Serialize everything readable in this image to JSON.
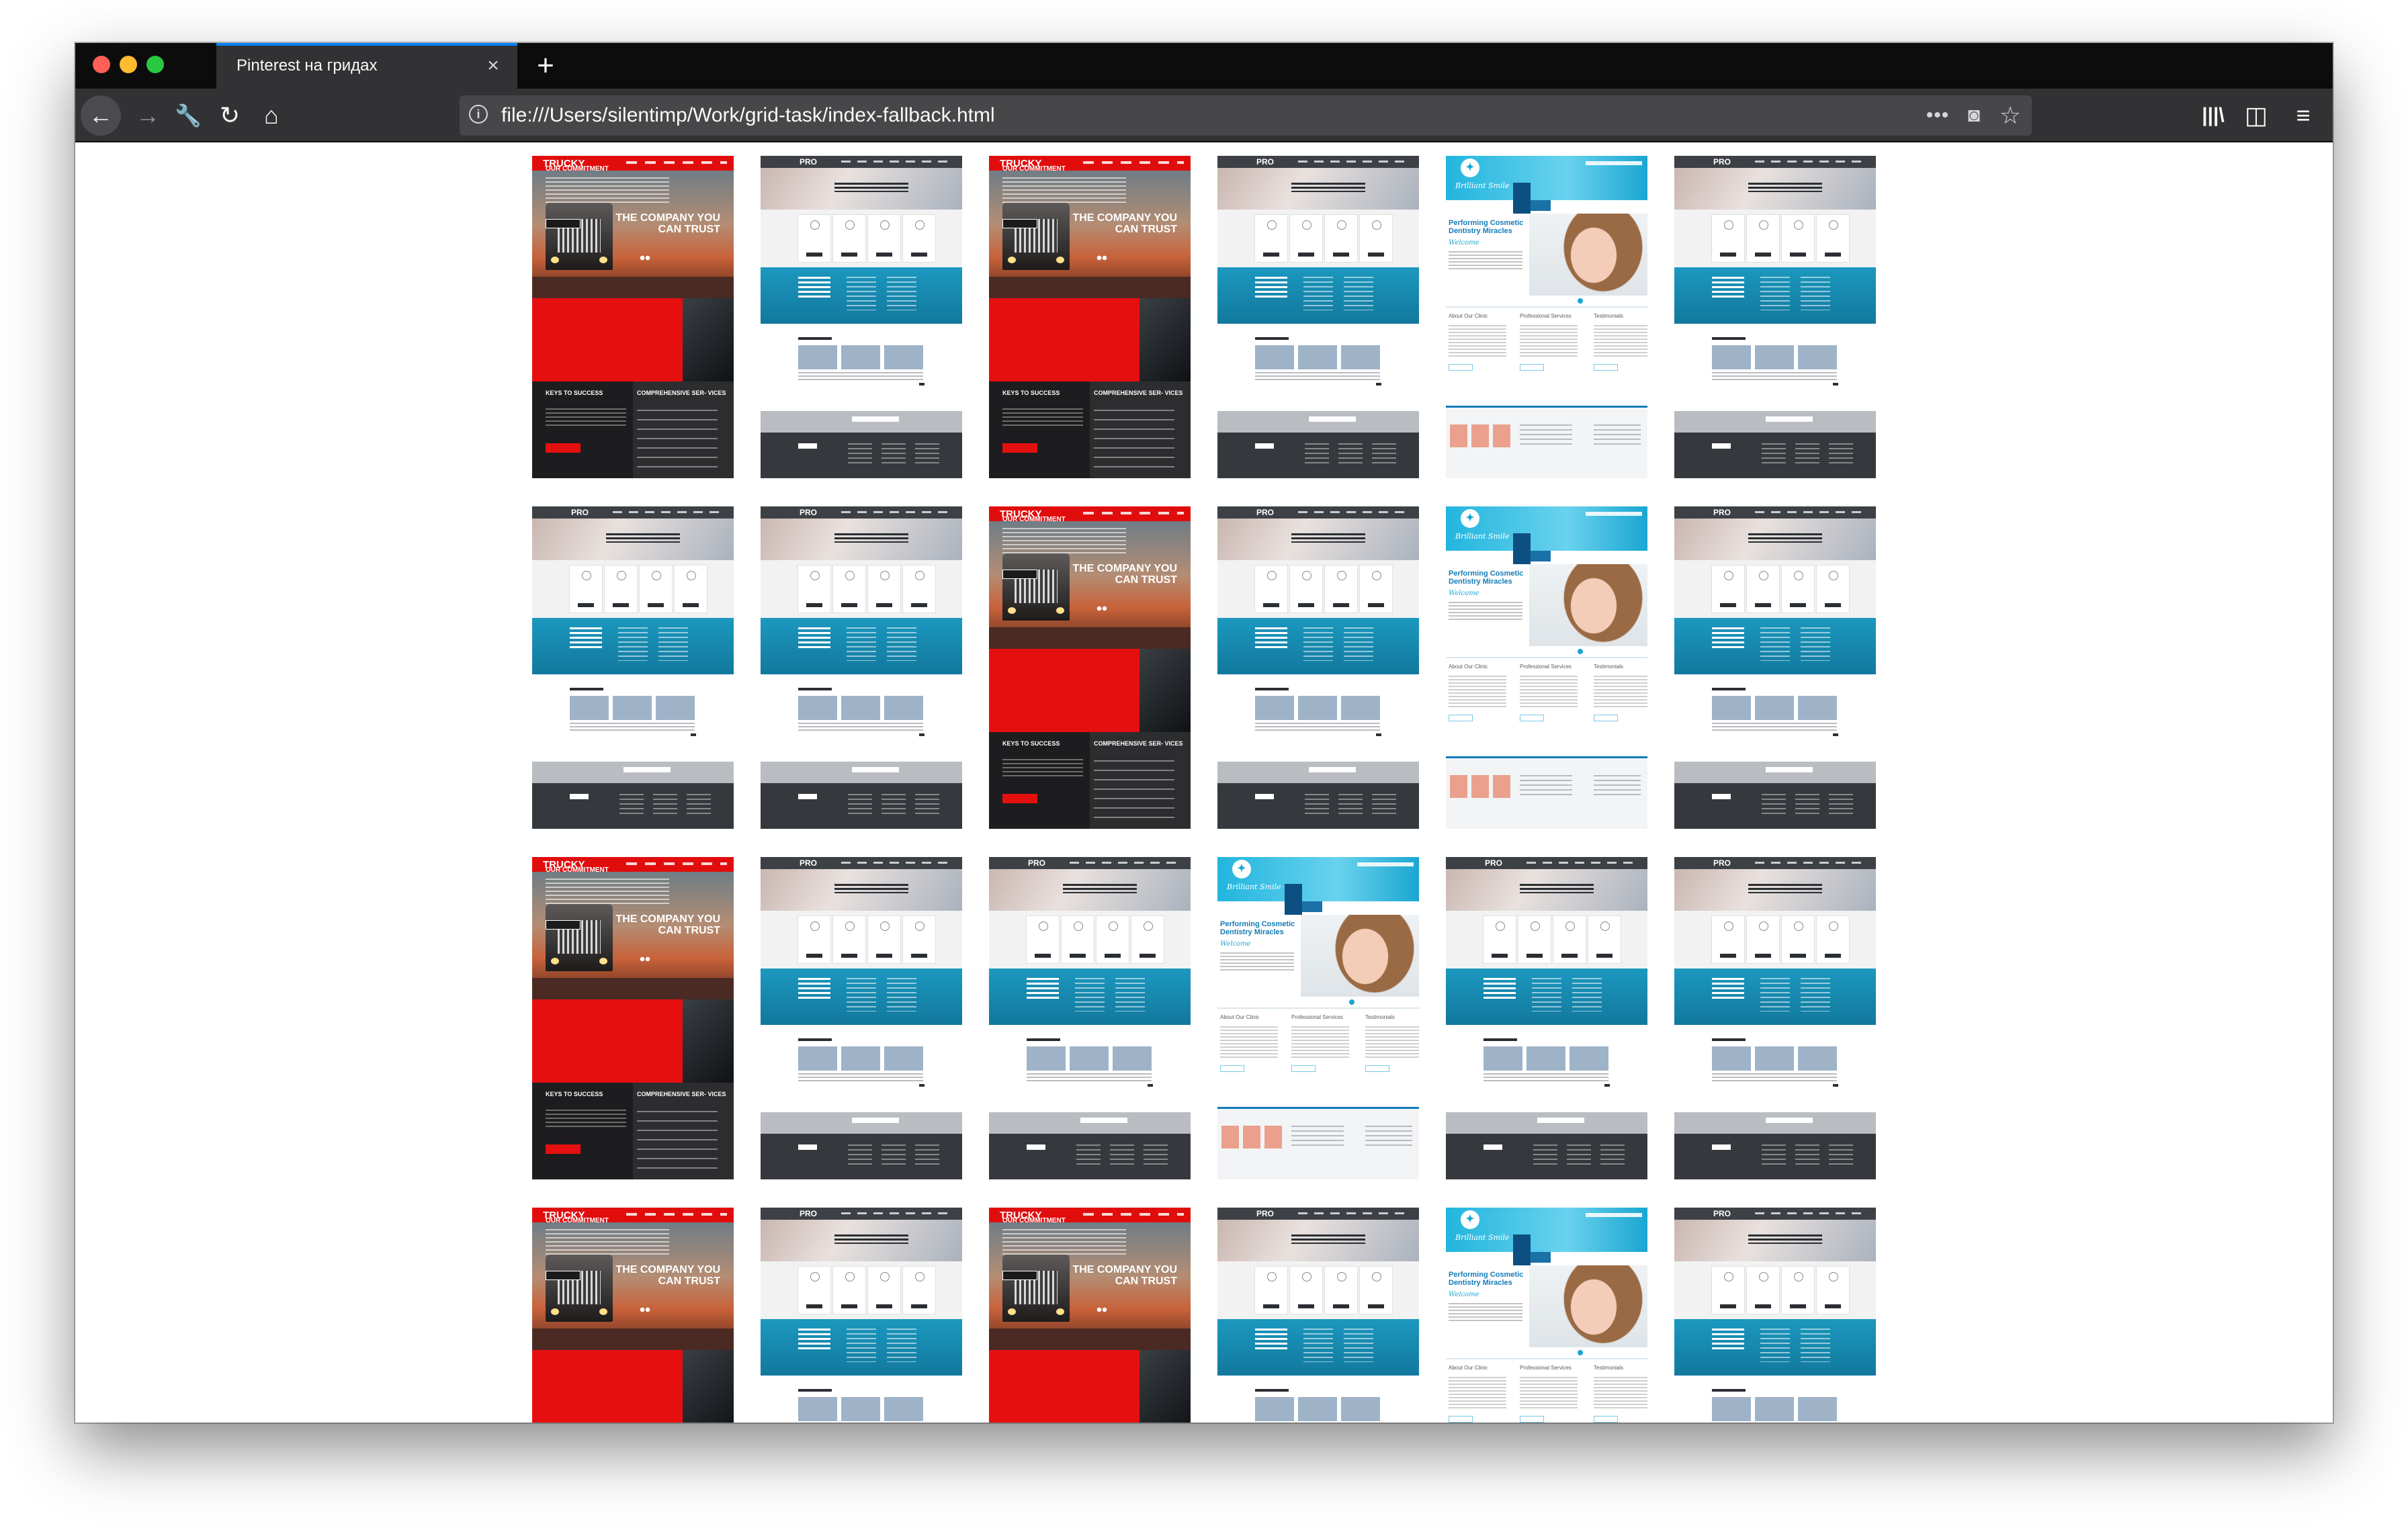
{
  "window": {
    "tab_title": "Pinterest на гридах",
    "tab_close": "×",
    "new_tab": "+"
  },
  "toolbar": {
    "back": "←",
    "forward": "→",
    "tools": "🔧",
    "reload": "↻",
    "home": "⌂",
    "info": "i",
    "url": "file:///Users/silentimp/Work/grid-task/index-fallback.html",
    "more": "•••",
    "pocket": "◙",
    "bookmark": "☆",
    "library": "|||\\",
    "sidebar": "◫",
    "menu": "≡"
  },
  "icons": {
    "back": "arrow-left-icon",
    "forward": "arrow-right-icon",
    "tools": "wrench-icon",
    "reload": "reload-icon",
    "home": "home-icon",
    "info": "info-icon",
    "more": "more-icon",
    "pocket": "pocket-icon",
    "bookmark": "star-icon",
    "library": "library-icon",
    "sidebar": "sidebar-icon",
    "menu": "hamburger-menu-icon",
    "close": "close-icon",
    "new_tab": "plus-icon"
  },
  "colors": {
    "tabstrip": "#0c0c0d",
    "toolbar": "#323234",
    "tab_highlight": "#0a84ff",
    "trucky_red": "#e60f0f",
    "pro_blue": "#1c98bf",
    "dental_blue": "#22b5de"
  },
  "templates": {
    "trucky": {
      "logo": "TRUCKY",
      "headline": "THE COMPANY YOU CAN TRUST",
      "commitment": "OUR COMMITMENT",
      "keys": "KEYS TO SUCCESS",
      "services": "COMPREHENSIVE SER- VICES"
    },
    "pro": {
      "logo": "PRO"
    },
    "dental": {
      "brand": "Brilliant Smile",
      "title": "Performing Cosmetic Dentistry Miracles",
      "welcome": "Welcome",
      "col1": "About Our Clinic",
      "col2": "Professional Services",
      "col3": "Testimonials"
    }
  },
  "grid": {
    "rows": [
      [
        "trucky",
        "pro",
        "trucky",
        "pro",
        "dental",
        "pro"
      ],
      [
        "pro",
        "pro",
        "trucky",
        "pro",
        "dental",
        "pro"
      ],
      [
        "trucky",
        "pro",
        "pro",
        "dental",
        "pro",
        "pro"
      ],
      [
        "trucky",
        "pro",
        "trucky",
        "pro",
        "dental",
        "pro"
      ]
    ]
  }
}
